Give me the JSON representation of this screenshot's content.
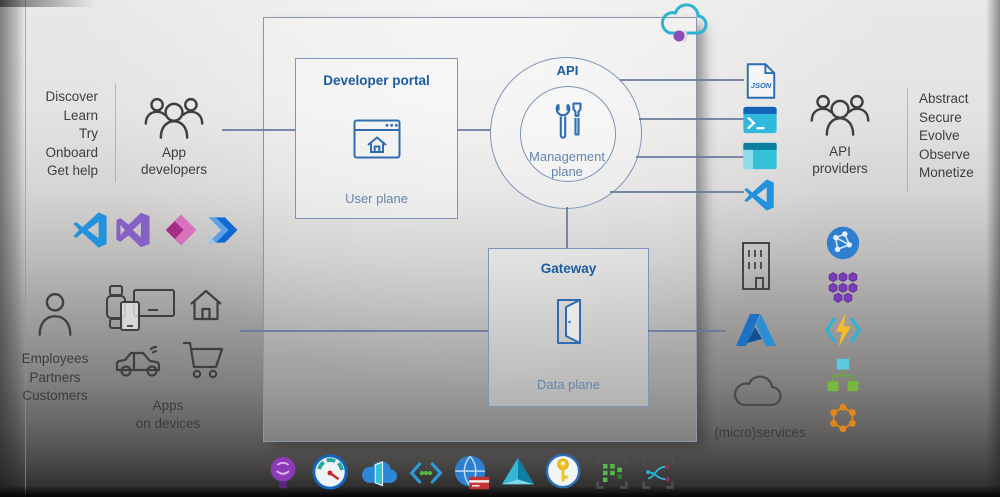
{
  "left_panel": {
    "activities": [
      "Discover",
      "Learn",
      "Try",
      "Onboard",
      "Get help"
    ],
    "app_developers_label": [
      "App",
      "developers"
    ],
    "audience": [
      "Employees",
      "Partners",
      "Customers"
    ],
    "devices_label": [
      "Apps",
      "on devices"
    ]
  },
  "center": {
    "developer_portal": {
      "title": "Developer portal",
      "plane": "User plane"
    },
    "api": {
      "title": "API",
      "plane": "Management plane"
    },
    "gateway": {
      "title": "Gateway",
      "plane": "Data plane"
    }
  },
  "right_panel": {
    "json_file_label": "JSON",
    "api_providers_label": [
      "API",
      "providers"
    ],
    "activities": [
      "Abstract",
      "Secure",
      "Evolve",
      "Observe",
      "Monetize"
    ],
    "microservices_label": "(micro)services"
  },
  "colors": {
    "diagram_line": "#64779a",
    "title_blue": "#1a5c9f",
    "plane_blue": "#6484ac",
    "dark_text": "#3c3c3c",
    "cloud_cyan": "#2cb3d4",
    "azure_blue": "#2b8fd8",
    "vscode_blue": "#2292dc",
    "visual_studio_purple": "#8661c5",
    "power_apps_pink": "#a62c88",
    "power_automate_blue": "#1268d3",
    "service_fabric_purple": "#7a3cbd",
    "functions_yellow": "#f6bc25",
    "org_chart_green": "#77b93e",
    "molecule_orange": "#e2861a"
  }
}
